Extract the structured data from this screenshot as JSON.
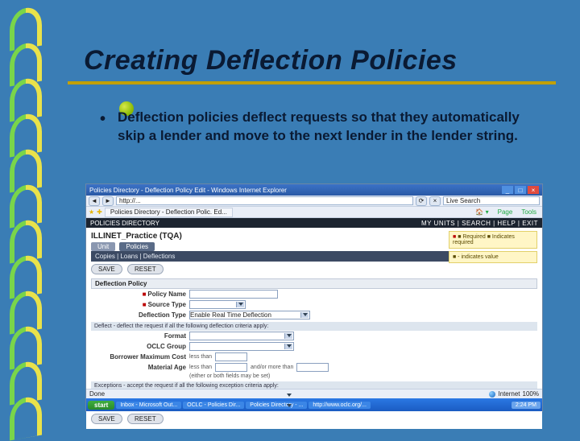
{
  "slide": {
    "title": "Creating Deflection Policies",
    "bullet": "Deflection policies deflect requests so that they automatically skip a lender and move to the next lender in the lender string."
  },
  "ie": {
    "window_title": "Policies Directory - Deflection Policy Edit - Windows Internet Explorer",
    "address": "http://...",
    "search_placeholder": "Live Search",
    "tab_label": "Policies Directory - Deflection Polic. Ed...",
    "toolbar": {
      "home": "Home",
      "page": "Page",
      "tools": "Tools"
    },
    "win_buttons": {
      "min": "_",
      "max": "□",
      "close": "×"
    },
    "nav": {
      "back": "◄",
      "forward": "►",
      "refresh": "⟳",
      "stop": "×"
    }
  },
  "app": {
    "brand": "POLICIES DIRECTORY",
    "topright": "MY UNITS | SEARCH | HELP | EXIT",
    "tenant": "ILLINET_Practice (TQA)",
    "tabs": {
      "unit": "Unit",
      "policies": "Policies"
    },
    "subnav": "Copies | Loans | Deflections",
    "buttons": {
      "save": "SAVE",
      "reset": "RESET"
    },
    "section1": "Deflection Policy",
    "fields": {
      "policy_name": "Policy Name",
      "source_type": "Source Type",
      "deflection_type": "Deflection Type",
      "deflection_type_value": "Enable Real Time Deflection",
      "format": "Format",
      "oclc_group": "OCLC Group",
      "borrower_max_cost": "Borrower Maximum Cost",
      "borrower_max_cost_value": "less than",
      "material_age": "Material Age",
      "material_age_value": "less than",
      "material_age_suffix": "and/or more than",
      "material_age_hint": "(either or both fields may be set)"
    },
    "note1": "Deflect - deflect the request if all the following deflection criteria apply:",
    "note2": "Exceptions - accept the request if all the following exception criteria apply:",
    "tips": {
      "tip1": "■ Required\n■ Indicates required",
      "tip2": "■ - indicates value"
    }
  },
  "status": {
    "done": "Done",
    "zone": "Internet",
    "zoom": "100%"
  },
  "taskbar": {
    "start": "start",
    "tasks": [
      "Inbox - Microsoft Out...",
      "OCLC - Policies Dir...",
      "Policies Directory - ...",
      "http://www.oclc.org/..."
    ],
    "time": "2:24 PM"
  }
}
